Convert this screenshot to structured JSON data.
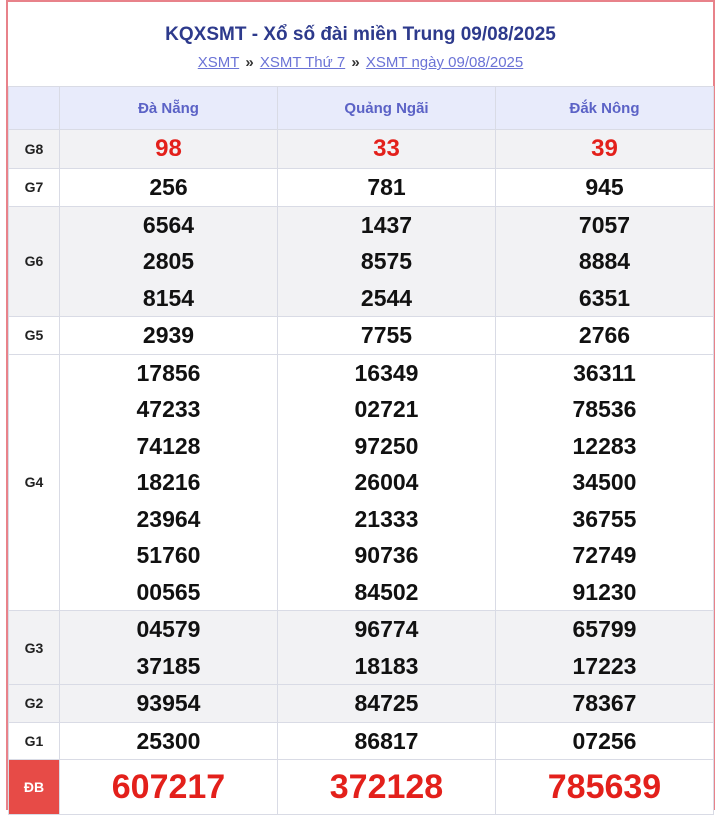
{
  "header": {
    "title": "KQXSMT - Xổ số đài miền Trung 09/08/2025",
    "crumbs": [
      "XSMT",
      "XSMT Thứ 7",
      "XSMT ngày 09/08/2025"
    ],
    "separator": "»"
  },
  "provinces": [
    "Đà Nẵng",
    "Quảng Ngãi",
    "Đắk Nông"
  ],
  "prizes": [
    {
      "label": "G8",
      "shade": true,
      "values": [
        [
          "98"
        ],
        [
          "33"
        ],
        [
          "39"
        ]
      ]
    },
    {
      "label": "G7",
      "shade": false,
      "values": [
        [
          "256"
        ],
        [
          "781"
        ],
        [
          "945"
        ]
      ]
    },
    {
      "label": "G6",
      "shade": true,
      "values": [
        [
          "6564",
          "2805",
          "8154"
        ],
        [
          "1437",
          "8575",
          "2544"
        ],
        [
          "7057",
          "8884",
          "6351"
        ]
      ]
    },
    {
      "label": "G5",
      "shade": false,
      "values": [
        [
          "2939"
        ],
        [
          "7755"
        ],
        [
          "2766"
        ]
      ]
    },
    {
      "label": "G4",
      "shade": false,
      "values": [
        [
          "17856",
          "47233",
          "74128",
          "18216",
          "23964",
          "51760",
          "00565"
        ],
        [
          "16349",
          "02721",
          "97250",
          "26004",
          "21333",
          "90736",
          "84502"
        ],
        [
          "36311",
          "78536",
          "12283",
          "34500",
          "36755",
          "72749",
          "91230"
        ]
      ]
    },
    {
      "label": "G3",
      "shade": true,
      "values": [
        [
          "04579",
          "37185"
        ],
        [
          "96774",
          "18183"
        ],
        [
          "65799",
          "17223"
        ]
      ]
    },
    {
      "label": "G2",
      "shade": true,
      "values": [
        [
          "93954"
        ],
        [
          "84725"
        ],
        [
          "78367"
        ]
      ]
    },
    {
      "label": "G1",
      "shade": false,
      "values": [
        [
          "25300"
        ],
        [
          "86817"
        ],
        [
          "07256"
        ]
      ]
    },
    {
      "label": "ĐB",
      "shade": false,
      "values": [
        [
          "607217"
        ],
        [
          "372128"
        ],
        [
          "785639"
        ]
      ]
    }
  ],
  "colors": {
    "accent_red": "#e3201b",
    "title_blue": "#2d3a8c",
    "link_blue": "#6b73d6",
    "header_bg": "#e8ebfb",
    "db_label_bg": "#e74b47"
  }
}
